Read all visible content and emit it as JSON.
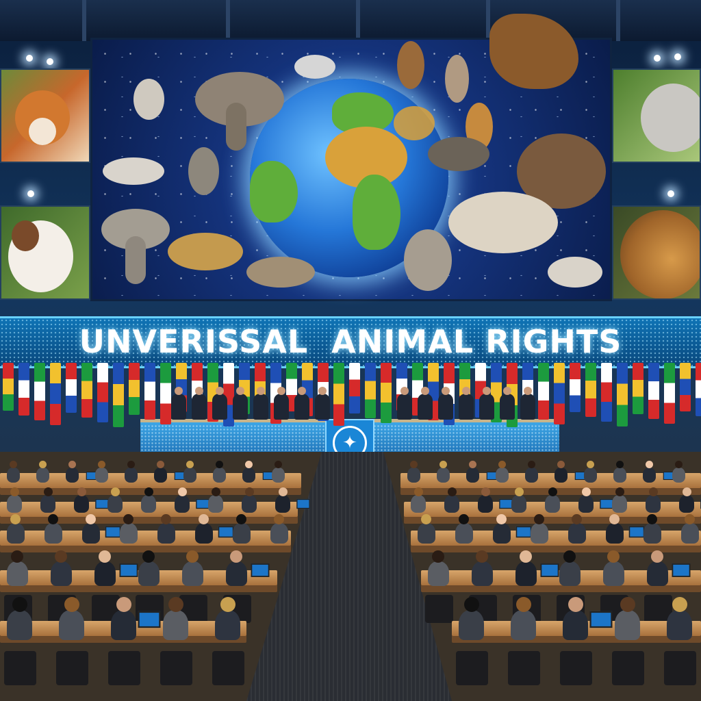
{
  "banner": {
    "title": "UNVERISSAL  ANIMAL RIGHTS"
  },
  "podium": {
    "emblem": "UN-emblem"
  },
  "colors": {
    "banner": "#0d6aa8",
    "title_text": "#ffffff",
    "globe_ocean": "#2577d8",
    "land": "#5fae3a",
    "desk_wood": "#c89058"
  },
  "icons": [
    "globe-icon",
    "un-emblem-icon",
    "animal-silhouette"
  ]
}
